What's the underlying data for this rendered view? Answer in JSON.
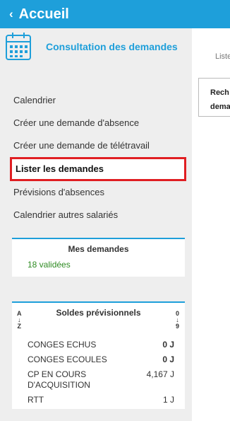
{
  "header": {
    "back_icon": "chevron-left-icon",
    "title": "Accueil"
  },
  "module": {
    "icon": "calendar-icon",
    "title": "Consultation des demandes"
  },
  "nav": {
    "items": [
      {
        "label": "Calendrier"
      },
      {
        "label": "Créer une demande d'absence"
      },
      {
        "label": "Créer une demande de télétravail"
      },
      {
        "label": "Lister les demandes"
      },
      {
        "label": "Prévisions d'absences"
      },
      {
        "label": "Calendrier autres salariés"
      }
    ],
    "active_index": 3
  },
  "mes_demandes": {
    "title": "Mes demandes",
    "value": "18 validées"
  },
  "soldes": {
    "title": "Soldes prévisionnels",
    "sort_alpha": {
      "top": "A",
      "bottom": "Z"
    },
    "sort_num": {
      "top": "0",
      "bottom": "9"
    },
    "rows": [
      {
        "label": "CONGES ECHUS",
        "value": "0 J"
      },
      {
        "label": "CONGES ECOULES",
        "value": "0 J"
      },
      {
        "label": "CP EN COURS D'ACQUISITION",
        "value": "4,167 J"
      },
      {
        "label": "RTT",
        "value": "1 J"
      }
    ]
  },
  "main": {
    "list_label": "Liste",
    "search_label": "Rech… dema…"
  },
  "colors": {
    "accent": "#1e9fda",
    "highlight_border": "#e01e22",
    "validated": "#2e8b22"
  }
}
